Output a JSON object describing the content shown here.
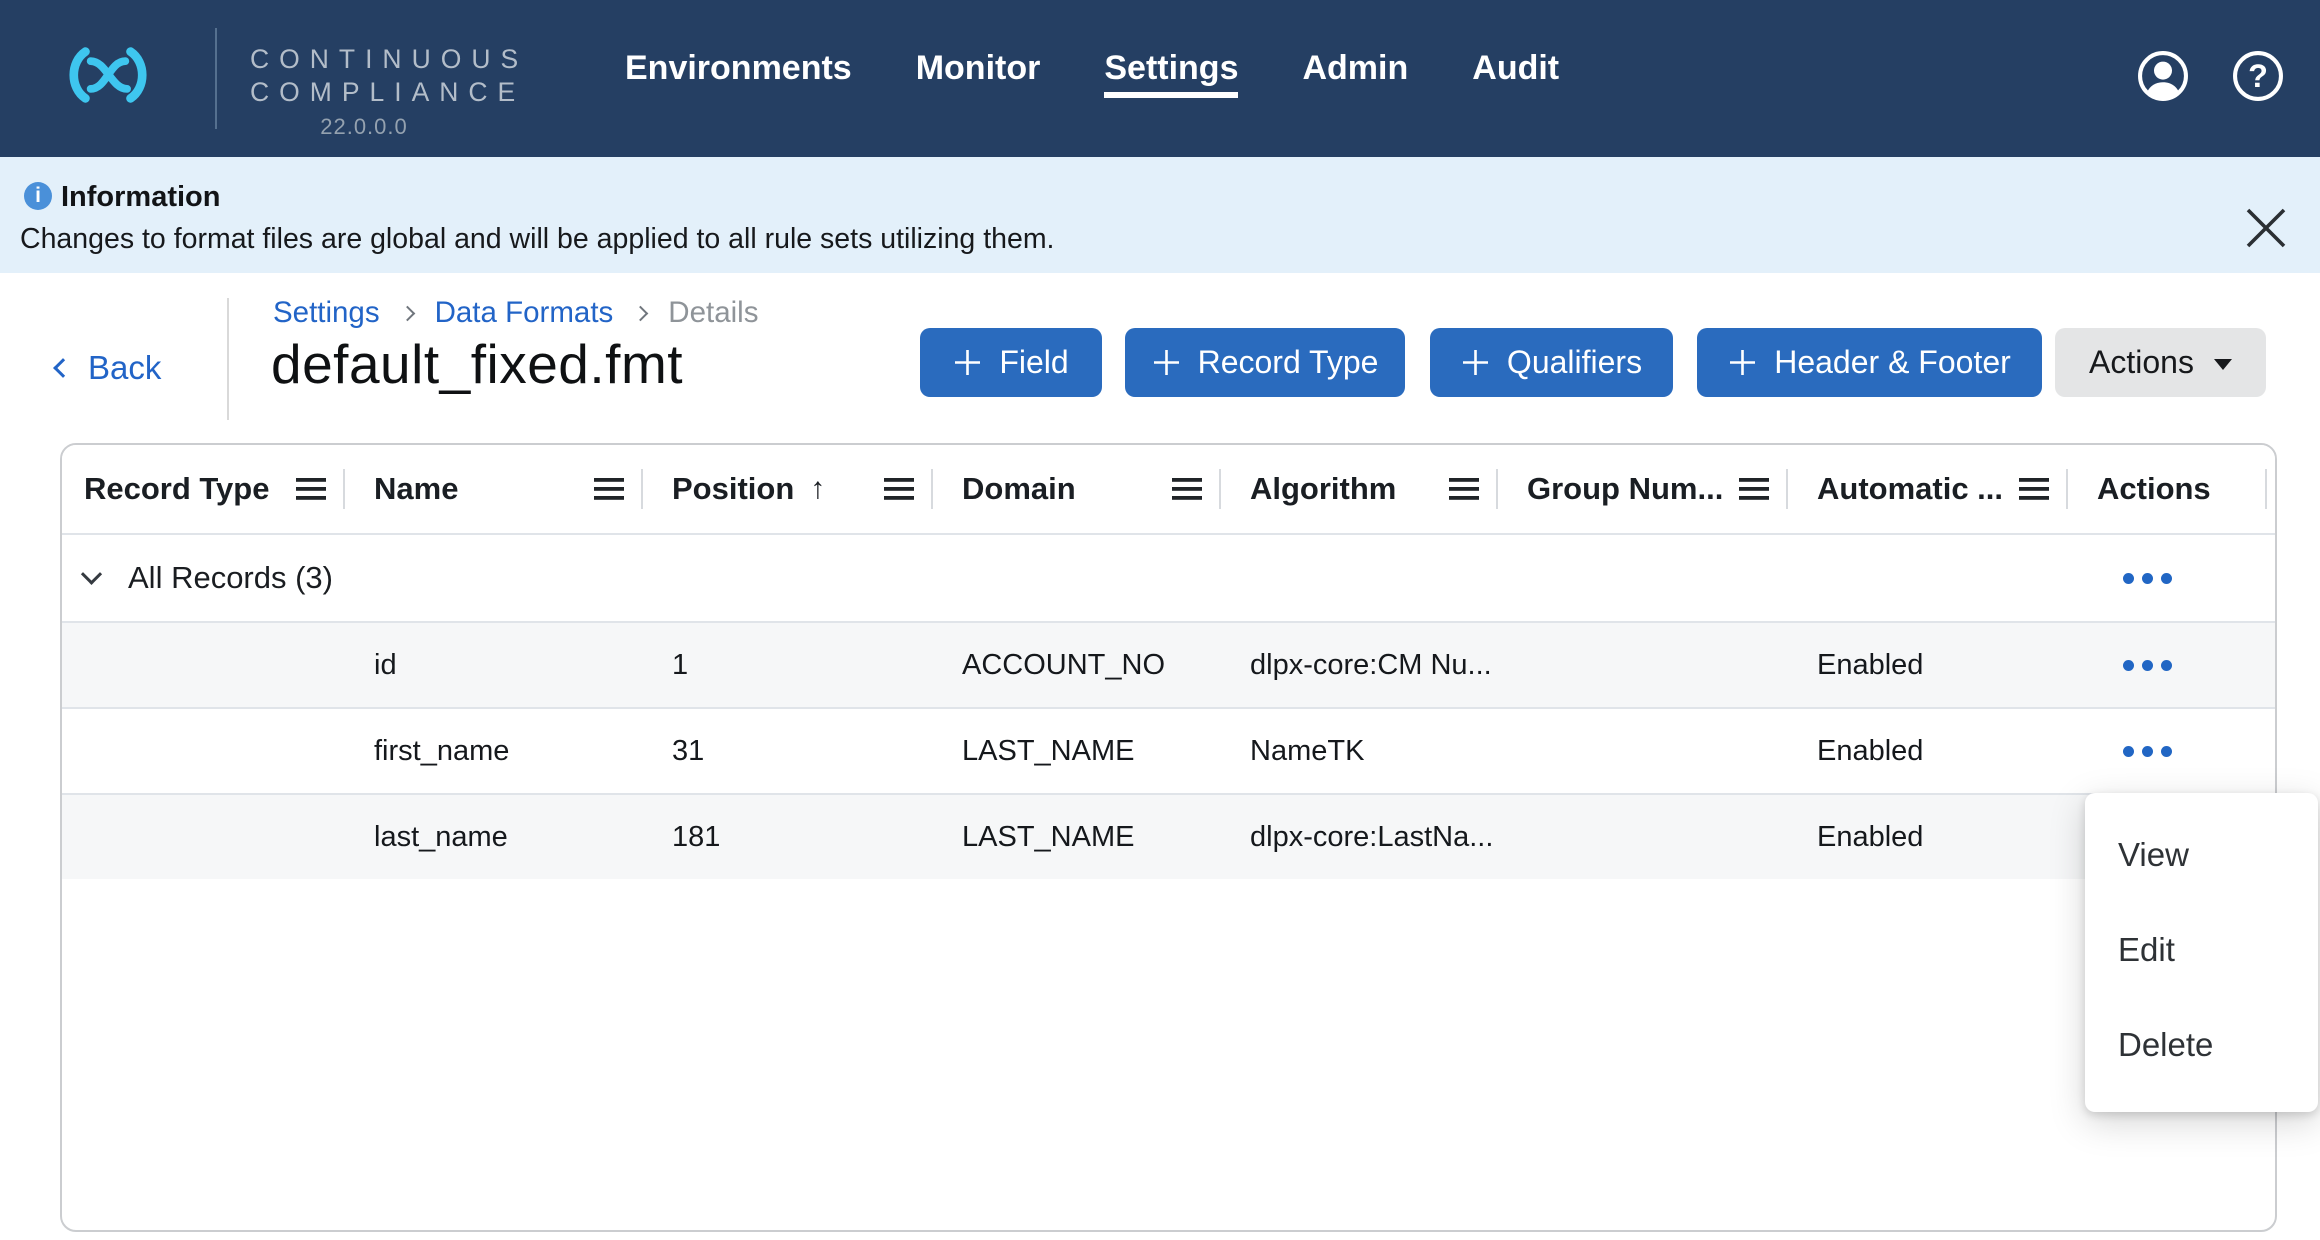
{
  "app": {
    "product_line1": "CONTINUOUS",
    "product_line2": "COMPLIANCE",
    "version": "22.0.0.0"
  },
  "nav": {
    "items": [
      {
        "label": "Environments",
        "active": false
      },
      {
        "label": "Monitor",
        "active": false
      },
      {
        "label": "Settings",
        "active": true
      },
      {
        "label": "Admin",
        "active": false
      },
      {
        "label": "Audit",
        "active": false
      }
    ]
  },
  "banner": {
    "title": "Information",
    "message": "Changes to format files are global and will be applied to all rule sets utilizing them."
  },
  "breadcrumb": {
    "items": [
      "Settings",
      "Data Formats",
      "Details"
    ]
  },
  "back_label": "Back",
  "page": {
    "title": "default_fixed.fmt"
  },
  "toolbar": {
    "buttons": [
      {
        "label": "Field"
      },
      {
        "label": "Record Type"
      },
      {
        "label": "Qualifiers"
      },
      {
        "label": "Header & Footer"
      }
    ],
    "actions_label": "Actions"
  },
  "table": {
    "columns": [
      {
        "label": "Record Type",
        "menu": true
      },
      {
        "label": "Name",
        "menu": true
      },
      {
        "label": "Position",
        "menu": true,
        "sort": "asc"
      },
      {
        "label": "Domain",
        "menu": true
      },
      {
        "label": "Algorithm",
        "menu": true
      },
      {
        "label": "Group Num...",
        "menu": true
      },
      {
        "label": "Automatic ...",
        "menu": true
      },
      {
        "label": "Actions",
        "menu": false
      }
    ],
    "group_row": {
      "label": "All Records (3)",
      "expanded": true
    },
    "rows": [
      {
        "record_type": "",
        "name": "id",
        "position": "1",
        "domain": "ACCOUNT_NO",
        "algorithm": "dlpx-core:CM Nu...",
        "automatic": "Enabled"
      },
      {
        "record_type": "",
        "name": "first_name",
        "position": "31",
        "domain": "LAST_NAME",
        "algorithm": "NameTK",
        "automatic": "Enabled"
      },
      {
        "record_type": "",
        "name": "last_name",
        "position": "181",
        "domain": "LAST_NAME",
        "algorithm": "dlpx-core:LastNa...",
        "automatic": "Enabled"
      }
    ]
  },
  "context_menu": {
    "items": [
      "View",
      "Edit",
      "Delete"
    ]
  },
  "icons": {
    "info": "i",
    "help": "?",
    "sort_ascending": "↑",
    "close": "✕",
    "column_menu": "☰",
    "row_actions": "•••",
    "user": "person-in-circle",
    "plus": "+",
    "caret_down": "▾",
    "back_chevron": "‹",
    "breadcrumb_separator": "›",
    "row_expander": "⌄"
  },
  "colors": {
    "navbar_bg": "#253f63",
    "logo_cyan": "#3ec6ef",
    "banner_bg": "#e3f0fa",
    "info_icon_blue": "#4a90d9",
    "primary_button": "#2a6bbe",
    "link": "#2264c7",
    "row_alt_bg": "#f6f7f8",
    "dots_blue": "#2166c4"
  }
}
